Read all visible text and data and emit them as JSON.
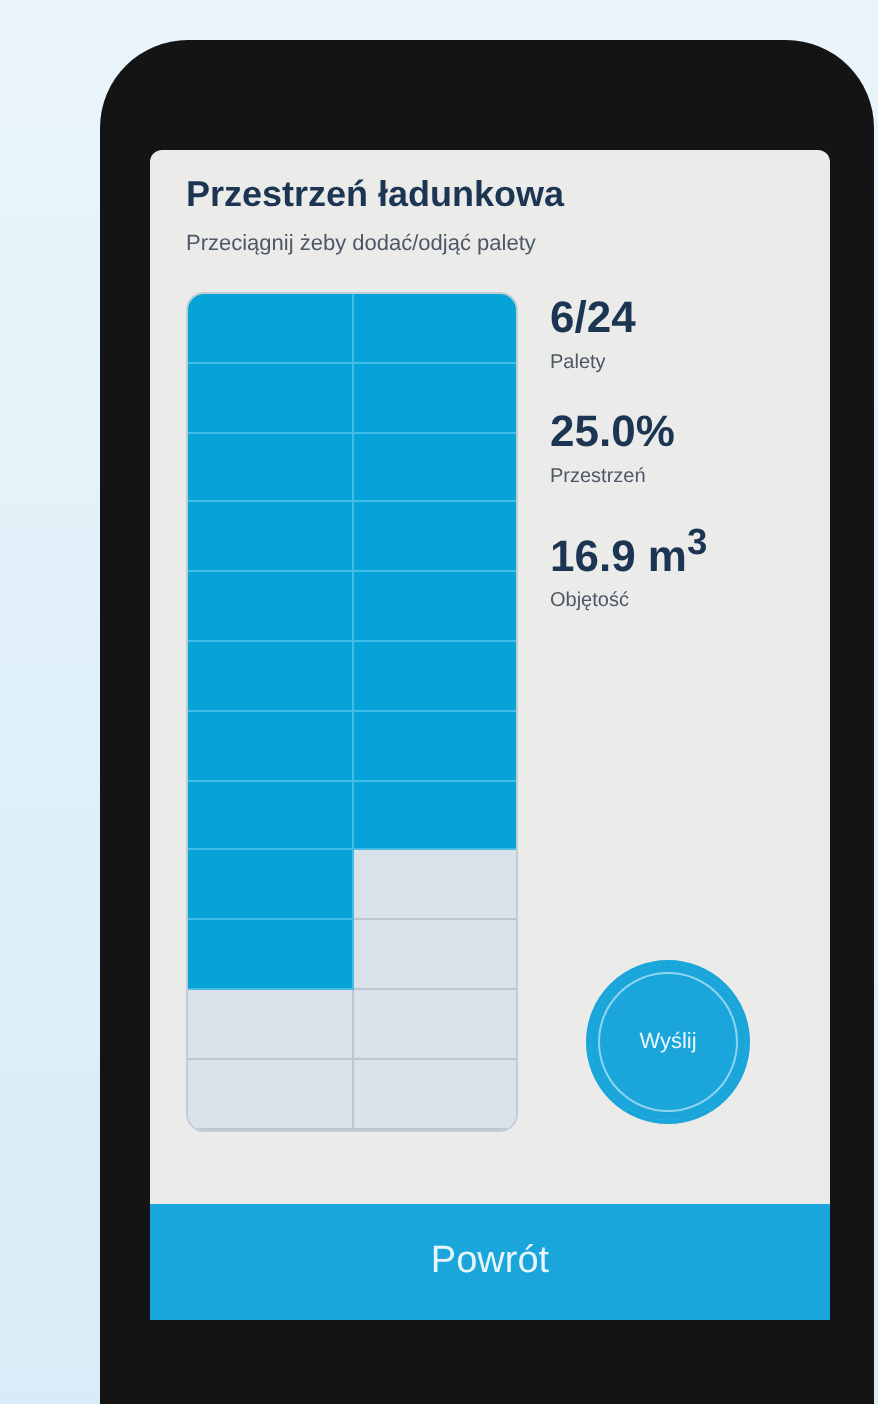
{
  "title": "Przestrzeń ładunkowa",
  "subtitle": "Przeciągnij żeby dodać/odjąć palety",
  "grid_rows": [
    {
      "cells": [
        {
          "filled": true
        },
        {
          "filled": true
        }
      ]
    },
    {
      "cells": [
        {
          "filled": true
        },
        {
          "filled": true
        }
      ]
    },
    {
      "cells": [
        {
          "filled": true
        },
        {
          "filled": true
        }
      ]
    },
    {
      "cells": [
        {
          "filled": true
        },
        {
          "filled": true
        }
      ]
    },
    {
      "cells": [
        {
          "filled": true
        },
        {
          "filled": true
        }
      ]
    },
    {
      "cells": [
        {
          "filled": true
        },
        {
          "filled": true
        }
      ]
    },
    {
      "cells": [
        {
          "filled": true
        },
        {
          "filled": true
        }
      ]
    },
    {
      "cells": [
        {
          "filled": true
        },
        {
          "filled": true
        }
      ]
    },
    {
      "cells": [
        {
          "filled": true
        },
        {
          "filled": false
        }
      ]
    },
    {
      "cells": [
        {
          "filled": true
        },
        {
          "filled": false
        }
      ]
    },
    {
      "cells": [
        {
          "filled": false
        },
        {
          "filled": false
        }
      ]
    },
    {
      "cells": [
        {
          "filled": false
        },
        {
          "filled": false
        }
      ]
    }
  ],
  "stats": [
    {
      "value": "6/24",
      "label": "Palety"
    },
    {
      "value": "25.0%",
      "label": "Przestrzeń"
    },
    {
      "value": "16.9 m$^{3}$",
      "label": "Objętość"
    }
  ],
  "send_button": "Wyślij",
  "back_button": "Powrót"
}
